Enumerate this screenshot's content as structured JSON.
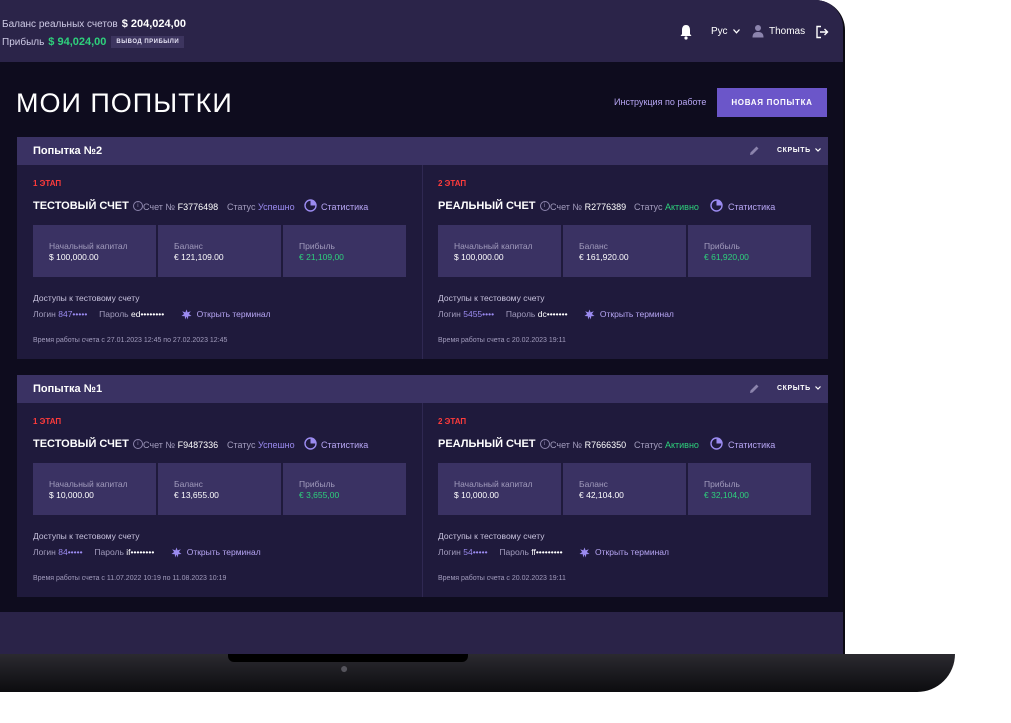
{
  "header": {
    "balance_label": "Баланс реальных счетов",
    "balance_value": "$ 204,024,00",
    "profit_label": "Прибыль",
    "profit_value": "$ 94,024,00",
    "withdraw_button": "вывод прибыли",
    "language": "Рус",
    "username": "Thomas"
  },
  "page": {
    "title": "МОИ ПОПЫТКИ",
    "instructions_link": "Инструкция по работе",
    "new_attempt_button": "НОВАЯ ПОПЫТКА"
  },
  "attempts": [
    {
      "name": "Попытка №2",
      "hide_label": "скрыть",
      "stages": [
        {
          "stage": "1 ЭТАП",
          "type": "ТЕСТОВЫЙ СЧЕТ",
          "account_label": "Счет №",
          "account_no": "F3776498",
          "status_label": "Статус",
          "status": "Успешно",
          "stats_link": "Статистика",
          "start_capital_label": "Начальный капитал",
          "start_capital": "$ 100,000.00",
          "balance_label": "Баланс",
          "balance": "€ 121,109.00",
          "profit_label": "Прибыль",
          "profit": "€  21,109,00",
          "access_label": "Доступы к тестовому счету",
          "login_label": "Логин",
          "login": "847•••••",
          "password_label": "Пароль",
          "password": "ed••••••••",
          "terminal_link": "Открыть терминал",
          "work_time": "Время работы счета с 27.01.2023 12:45 по 27.02.2023 12:45"
        },
        {
          "stage": "2 ЭТАП",
          "type": "РЕАЛЬНЫЙ СЧЕТ",
          "account_label": "Счет №",
          "account_no": "R2776389",
          "status_label": "Статус",
          "status": "Активно",
          "stats_link": "Статистика",
          "start_capital_label": "Начальный капитал",
          "start_capital": "$ 100,000.00",
          "balance_label": "Баланс",
          "balance": "€ 161,920.00",
          "profit_label": "Прибыль",
          "profit": "€  61,920,00",
          "access_label": "Доступы к тестовому счету",
          "login_label": "Логин",
          "login": "5455••••",
          "password_label": "Пароль",
          "password": "dc•••••••",
          "terminal_link": "Открыть терминал",
          "work_time": "Время работы счета с 20.02.2023 19:11"
        }
      ]
    },
    {
      "name": "Попытка №1",
      "hide_label": "скрыть",
      "stages": [
        {
          "stage": "1 ЭТАП",
          "type": "ТЕСТОВЫЙ СЧЕТ",
          "account_label": "Счет №",
          "account_no": "F9487336",
          "status_label": "Статус",
          "status": "Успешно",
          "stats_link": "Статистика",
          "start_capital_label": "Начальный капитал",
          "start_capital": "$ 10,000.00",
          "balance_label": "Баланс",
          "balance": "€ 13,655.00",
          "profit_label": "Прибыль",
          "profit": "€  3,655,00",
          "access_label": "Доступы к тестовому счету",
          "login_label": "Логин",
          "login": "84•••••",
          "password_label": "Пароль",
          "password": "if••••••••",
          "terminal_link": "Открыть терминал",
          "work_time": "Время работы счета с 11.07.2022 10:19 по 11.08.2023 10:19"
        },
        {
          "stage": "2 ЭТАП",
          "type": "РЕАЛЬНЫЙ СЧЕТ",
          "account_label": "Счет №",
          "account_no": "R7666350",
          "status_label": "Статус",
          "status": "Активно",
          "stats_link": "Статистика",
          "start_capital_label": "Начальный капитал",
          "start_capital": "$ 10,000.00",
          "balance_label": "Баланс",
          "balance": "€ 42,104.00",
          "profit_label": "Прибыль",
          "profit": "€  32,104,00",
          "access_label": "Доступы к тестовому счету",
          "login_label": "Логин",
          "login": "54•••••",
          "password_label": "Пароль",
          "password": "ff•••••••••",
          "terminal_link": "Открыть терминал",
          "work_time": "Время работы счета с 20.02.2023 19:11"
        }
      ]
    }
  ],
  "colors": {
    "accent": "#6b56c9",
    "link": "#b7a6f4",
    "success": "#2ed17c",
    "stage": "#ff3b3b",
    "panel": "#3a3263"
  },
  "icons": [
    "bell-icon",
    "chevron-down-icon",
    "user-icon",
    "logout-icon",
    "pencil-icon",
    "info-icon",
    "pie-chart-icon",
    "terminal-icon",
    "apple-logo-icon"
  ]
}
